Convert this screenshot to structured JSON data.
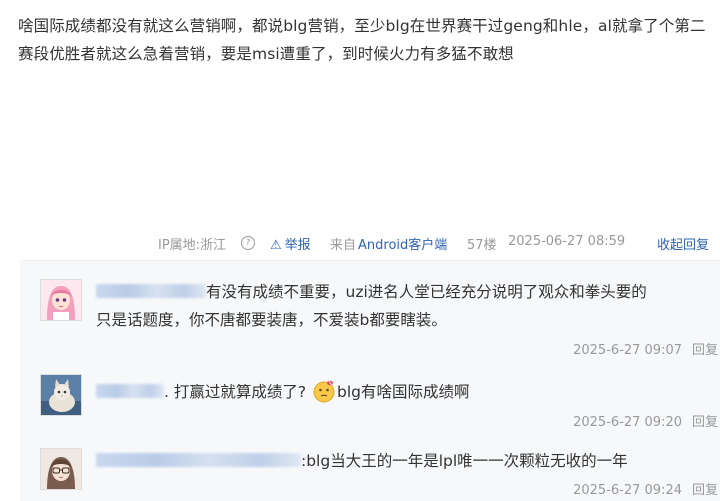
{
  "post": {
    "text": "啥国际成绩都没有就这么营销啊，都说blg营销，至少blg在世界赛干过geng和hle，al就拿了个第二赛段优胜者就这么急着营销，要是msi遭重了，到时候火力有多猛不敢想"
  },
  "meta": {
    "ip_location": "IP属地:浙江",
    "help_icon": "?",
    "report_icon": "warning-triangle-icon",
    "report": "举报",
    "source_prefix": "来自",
    "source_client": "Android客户端",
    "floor": "57楼",
    "time": "2025-06-27 08:59",
    "collapse_reply": "收起回复"
  },
  "replies": [
    {
      "avatar_icon": "anime-girl-avatar-icon",
      "text_line1": "有没有成绩不重要，uzi进名人堂已经充分说明了观众和拳头要的",
      "text_line2": "只是话题度，你不唐都要装唐，不爱装b都要瞎装。",
      "time": "2025-6-27 09:07",
      "reply_label": "回复"
    },
    {
      "avatar_icon": "cat-photo-avatar-icon",
      "text_before": ". 打赢过就算成绩了?",
      "emoji_icon": "thinking-face-emoji",
      "text_after": "blg有啥国际成绩啊",
      "time": "2025-6-27 09:20",
      "reply_label": "回复"
    },
    {
      "avatar_icon": "glasses-boy-avatar-icon",
      "text": ":blg当大王的一年是lpl唯一一次颗粒无收的一年",
      "time": "2025-6-27 09:24",
      "reply_label": "回复"
    }
  ],
  "colors": {
    "link_blue": "#2d64b3",
    "meta_gray": "#999999",
    "reply_bg": "#f7f8fa"
  }
}
